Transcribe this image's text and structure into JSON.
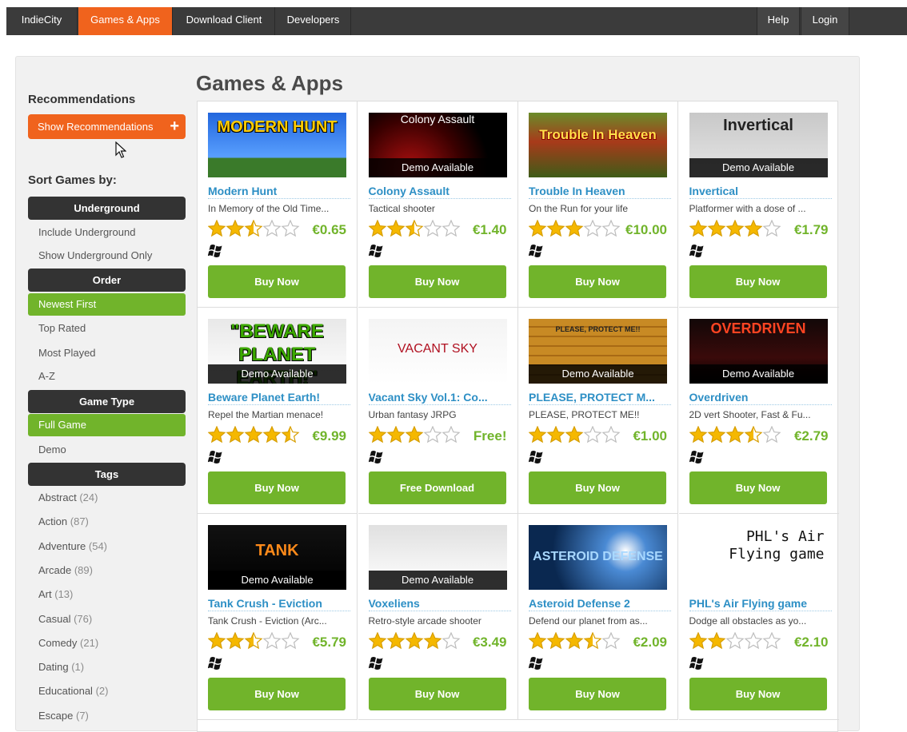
{
  "nav": {
    "left": [
      {
        "label": "IndieCity",
        "active": false
      },
      {
        "label": "Games & Apps",
        "active": true
      },
      {
        "label": "Download Client",
        "active": false
      },
      {
        "label": "Developers",
        "active": false
      }
    ],
    "right": [
      {
        "label": "Help"
      },
      {
        "label": "Login"
      }
    ]
  },
  "sidebar": {
    "recommendations_heading": "Recommendations",
    "show_recommendations_label": "Show Recommendations",
    "sort_heading": "Sort Games by:",
    "underground": {
      "heading": "Underground",
      "options": [
        {
          "label": "Include Underground",
          "selected": false
        },
        {
          "label": "Show Underground Only",
          "selected": false
        }
      ]
    },
    "order": {
      "heading": "Order",
      "options": [
        {
          "label": "Newest First",
          "selected": true
        },
        {
          "label": "Top Rated",
          "selected": false
        },
        {
          "label": "Most Played",
          "selected": false
        },
        {
          "label": "A-Z",
          "selected": false
        }
      ]
    },
    "game_type": {
      "heading": "Game Type",
      "options": [
        {
          "label": "Full Game",
          "selected": true
        },
        {
          "label": "Demo",
          "selected": false
        }
      ]
    },
    "tags": {
      "heading": "Tags",
      "items": [
        {
          "label": "Abstract",
          "count": "(24)"
        },
        {
          "label": "Action",
          "count": "(87)"
        },
        {
          "label": "Adventure",
          "count": "(54)"
        },
        {
          "label": "Arcade",
          "count": "(89)"
        },
        {
          "label": "Art",
          "count": "(13)"
        },
        {
          "label": "Casual",
          "count": "(76)"
        },
        {
          "label": "Comedy",
          "count": "(21)"
        },
        {
          "label": "Dating",
          "count": "(1)"
        },
        {
          "label": "Educational",
          "count": "(2)"
        },
        {
          "label": "Escape",
          "count": "(7)"
        }
      ]
    }
  },
  "main": {
    "title": "Games & Apps",
    "demo_label": "Demo Available",
    "games": [
      {
        "title": "Modern Hunt",
        "desc": "In Memory of the Old Time...",
        "rating": 2.5,
        "price": "€0.65",
        "button": "Buy Now",
        "demo": false,
        "thumb_text": "MODERN HUNT"
      },
      {
        "title": "Colony Assault",
        "desc": "Tactical shooter",
        "rating": 2.5,
        "price": "€1.40",
        "button": "Buy Now",
        "demo": true,
        "thumb_text": "Colony Assault"
      },
      {
        "title": "Trouble In Heaven",
        "desc": "On the Run for your life",
        "rating": 3,
        "price": "€10.00",
        "button": "Buy Now",
        "demo": false,
        "thumb_text": "Trouble In Heaven"
      },
      {
        "title": "Invertical",
        "desc": "Platformer with a dose of ...",
        "rating": 4,
        "price": "€1.79",
        "button": "Buy Now",
        "demo": true,
        "thumb_text": "Invertical"
      },
      {
        "title": "Beware Planet Earth!",
        "desc": "Repel the Martian menace!",
        "rating": 4.5,
        "price": "€9.99",
        "button": "Buy Now",
        "demo": true,
        "thumb_text": "\"BEWARE PLANET EARTH!\""
      },
      {
        "title": "Vacant Sky Vol.1: Co...",
        "desc": "Urban fantasy JRPG",
        "rating": 3,
        "price": "Free!",
        "button": "Free Download",
        "demo": false,
        "thumb_text": "VACANT SKY"
      },
      {
        "title": "PLEASE, PROTECT M...",
        "desc": "PLEASE, PROTECT ME!!",
        "rating": 3,
        "price": "€1.00",
        "button": "Buy Now",
        "demo": true,
        "thumb_text": "PLEASE, PROTECT ME!!"
      },
      {
        "title": "Overdriven",
        "desc": "2D vert Shooter, Fast & Fu...",
        "rating": 3.5,
        "price": "€2.79",
        "button": "Buy Now",
        "demo": true,
        "thumb_text": "OVERDRIVEN"
      },
      {
        "title": "Tank Crush - Eviction",
        "desc": "Tank Crush - Eviction (Arc...",
        "rating": 2.5,
        "price": "€5.79",
        "button": "Buy Now",
        "demo": true,
        "thumb_text": "TANK"
      },
      {
        "title": "Voxeliens",
        "desc": "Retro-style arcade shooter",
        "rating": 4,
        "price": "€3.49",
        "button": "Buy Now",
        "demo": true,
        "thumb_text": ""
      },
      {
        "title": "Asteroid Defense 2",
        "desc": "Defend our planet from as...",
        "rating": 3.5,
        "price": "€2.09",
        "button": "Buy Now",
        "demo": false,
        "thumb_text": "ASTEROID DEFENSE"
      },
      {
        "title": "PHL's Air Flying game",
        "desc": "Dodge all obstacles as yo...",
        "rating": 2,
        "price": "€2.10",
        "button": "Buy Now",
        "demo": false,
        "thumb_text": "PHL's Air Flying game"
      }
    ]
  },
  "colors": {
    "accent_orange": "#f0631d",
    "accent_green": "#71b42b",
    "link_blue": "#2d8fc5",
    "star_gold": "#f5b800"
  }
}
